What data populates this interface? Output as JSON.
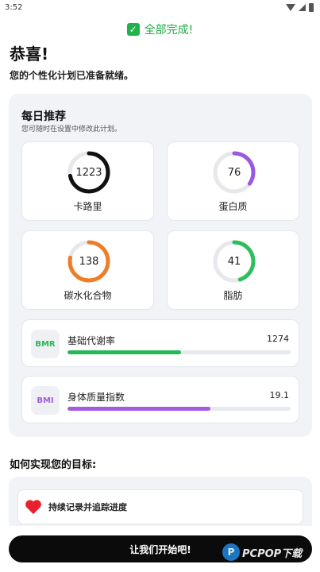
{
  "status_bar": {
    "time": "3:52"
  },
  "banner": {
    "text": "全部完成!"
  },
  "header": {
    "title": "恭喜!",
    "subtitle": "您的个性化计划已准备就绪。"
  },
  "daily": {
    "title": "每日推荐",
    "subtitle": "您可随时在设置中修改此计划。",
    "tiles": [
      {
        "label": "卡路里",
        "value": "1223",
        "progress": 0.72,
        "color": "#111111"
      },
      {
        "label": "蛋白质",
        "value": "76",
        "progress": 0.35,
        "color": "#9b59e0"
      },
      {
        "label": "碳水化合物",
        "value": "138",
        "progress": 0.78,
        "color": "#ef7d28"
      },
      {
        "label": "脂肪",
        "value": "41",
        "progress": 0.45,
        "color": "#2fbe5f"
      }
    ],
    "stats": [
      {
        "badge": "BMR",
        "name": "基础代谢率",
        "value": "1274",
        "progress": 0.51,
        "color": "#27b856"
      },
      {
        "badge": "BMI",
        "name": "身体质量指数",
        "value": "19.1",
        "progress": 0.64,
        "color": "#a35be0"
      }
    ]
  },
  "how": {
    "title": "如何实现您的目标:",
    "items": [
      {
        "label": "持续记录并追踪进度",
        "icon": "heart-icon"
      }
    ]
  },
  "cta": {
    "label": "让我们开始吧!"
  },
  "watermark": {
    "text": "PCPOP下载"
  },
  "colors": {
    "accent_green": "#22a845",
    "button_bg": "#0b0b0b",
    "panel_bg": "#f1f3f7"
  }
}
